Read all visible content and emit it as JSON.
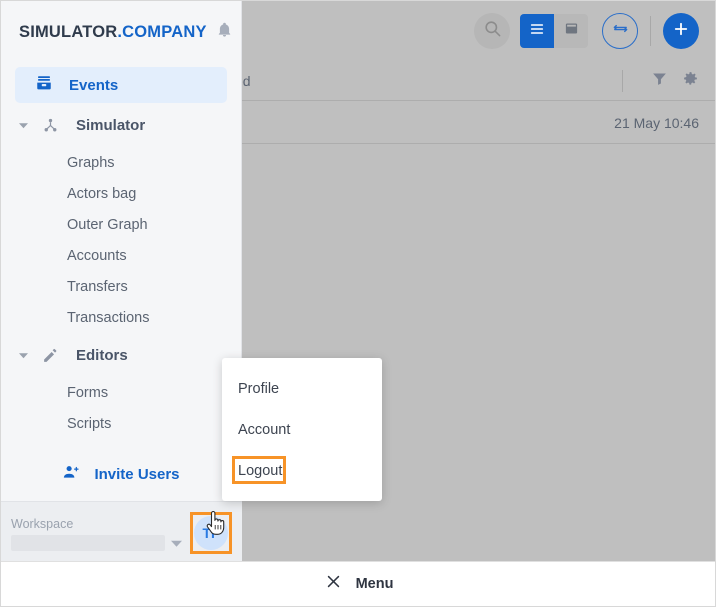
{
  "brand": {
    "name_primary": "SIMULATOR",
    "name_secondary": ".COMPANY",
    "bell_icon": "bell-icon"
  },
  "sidebar": {
    "active_item": {
      "label": "Events",
      "icon": "inbox-icon"
    },
    "groups": [
      {
        "label": "Simulator",
        "icon": "hierarchy-icon",
        "caret": "caret-down-icon",
        "items": [
          "Graphs",
          "Actors bag",
          "Outer Graph",
          "Accounts",
          "Transfers",
          "Transactions"
        ]
      },
      {
        "label": "Editors",
        "icon": "pencil-icon",
        "caret": "caret-down-icon",
        "items": [
          "Forms",
          "Scripts"
        ]
      }
    ],
    "invite": {
      "label": "Invite Users",
      "icon": "person-add-icon"
    },
    "workspace": {
      "label": "Workspace",
      "value": "",
      "placeholder": "",
      "caret": "caret-down-icon"
    },
    "avatar": {
      "initials": "TF"
    }
  },
  "toolbar": {
    "search_icon": "search-icon",
    "list_view_icon": "list-view-icon",
    "card_view_icon": "card-view-icon",
    "swap_icon": "swap-horizontal-icon",
    "add_icon": "plus-icon"
  },
  "content": {
    "header_text": "ed",
    "filter_icon": "filter-icon",
    "settings_icon": "gear-icon",
    "rows": [
      {
        "date": "21 May 10:46"
      }
    ]
  },
  "dropdown": {
    "items": [
      "Profile",
      "Account",
      "Logout"
    ]
  },
  "menu_bar": {
    "close_icon": "close-icon",
    "label": "Menu"
  },
  "colors": {
    "accent_blue": "#1464c8",
    "highlight_orange": "#f79327",
    "sidebar_bg": "#f5f6f8",
    "overlay_dim": "#bfbfbf",
    "avatar_bg": "#cfe2fb"
  }
}
